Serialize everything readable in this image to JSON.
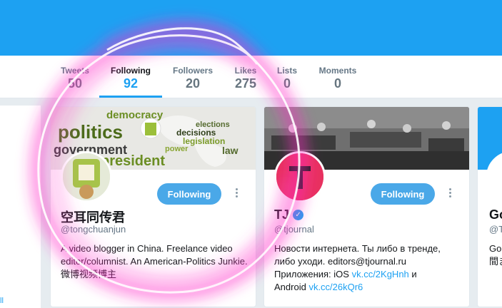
{
  "nav": {
    "stats": [
      {
        "label": "Tweets",
        "count": "50"
      },
      {
        "label": "Following",
        "count": "92"
      },
      {
        "label": "Followers",
        "count": "20"
      },
      {
        "label": "Likes",
        "count": "275"
      },
      {
        "label": "Lists",
        "count": "0"
      },
      {
        "label": "Moments",
        "count": "0"
      }
    ]
  },
  "left_panel": {
    "link": "ll"
  },
  "cards": [
    {
      "name": "空耳同传君",
      "handle": "@tongchuanjun",
      "button": "Following",
      "bio": "A video blogger in China. Freelance video editor/columnist. An American-Politics Junkie. 微博视频博主",
      "header_words": [
        "democracy",
        "politics",
        "elections",
        "decisions",
        "legislation",
        "government",
        "president",
        "law",
        "power"
      ]
    },
    {
      "name": "TJ",
      "handle": "@tjournal",
      "button": "Following",
      "bio_lines": [
        "Новости интернета. Ты либо в тренде,",
        "либо уходи. editors@tjournal.ru",
        "Приложения: iOS",
        "и",
        "Android"
      ],
      "bio_links": [
        "vk.cc/2KgHnh",
        "vk.cc/26kQr6"
      ]
    },
    {
      "name_partial": "Go",
      "handle_partial": "@T",
      "bio_partial_1": "Go",
      "bio_partial_2": "間ま"
    }
  ],
  "colors": {
    "accent": "#1da1f2",
    "button": "#4aa8e8",
    "scribble": "#ff33cc"
  }
}
